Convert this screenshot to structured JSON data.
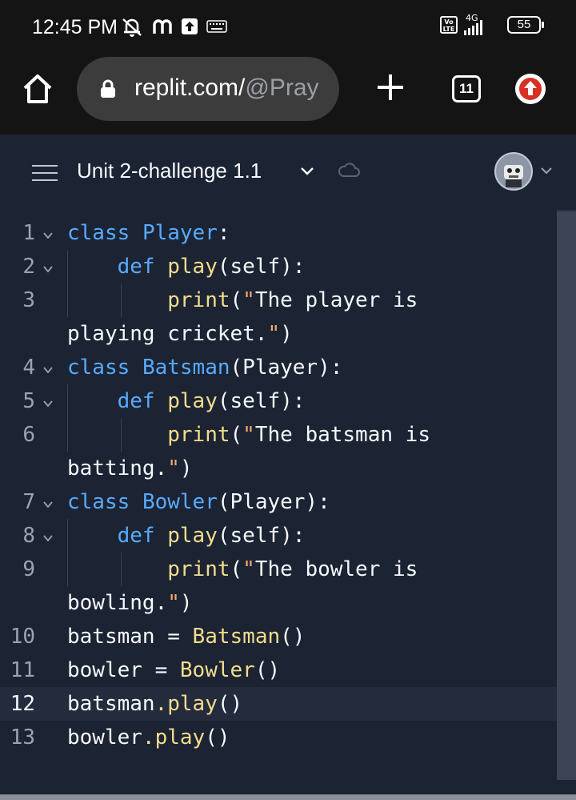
{
  "status_bar": {
    "time": "12:45 PM",
    "left_icons": [
      "mute-icon",
      "m-app-icon",
      "upload-icon",
      "keyboard-icon"
    ],
    "volte": "Vo LTE",
    "network": "4G",
    "battery": "55"
  },
  "browser": {
    "url_host": "replit.com/",
    "url_path": "@Pray",
    "tab_count": "11"
  },
  "replit": {
    "title": "Unit 2-challenge 1.1"
  },
  "editor": {
    "active_line": "12",
    "lines": [
      {
        "num": "1",
        "fold": true,
        "code": "class Player:"
      },
      {
        "num": "2",
        "fold": true,
        "code": "    def play(self):"
      },
      {
        "num": "3",
        "fold": false,
        "code": "        print(\"The player is"
      },
      {
        "num": "",
        "fold": false,
        "code": "playing cricket.\")"
      },
      {
        "num": "4",
        "fold": true,
        "code": "class Batsman(Player):"
      },
      {
        "num": "5",
        "fold": true,
        "code": "    def play(self):"
      },
      {
        "num": "6",
        "fold": false,
        "code": "        print(\"The batsman is"
      },
      {
        "num": "",
        "fold": false,
        "code": "batting.\")"
      },
      {
        "num": "7",
        "fold": true,
        "code": "class Bowler(Player):"
      },
      {
        "num": "8",
        "fold": true,
        "code": "    def play(self):"
      },
      {
        "num": "9",
        "fold": false,
        "code": "        print(\"The bowler is"
      },
      {
        "num": "",
        "fold": false,
        "code": "bowling.\")"
      },
      {
        "num": "10",
        "fold": false,
        "code": "batsman = Batsman()"
      },
      {
        "num": "11",
        "fold": false,
        "code": "bowler = Bowler()"
      },
      {
        "num": "12",
        "fold": false,
        "code": "batsman.play()"
      },
      {
        "num": "13",
        "fold": false,
        "code": "bowler.play()"
      }
    ]
  },
  "colors": {
    "background": "#1c2333",
    "keyword": "#57abff",
    "function": "#f2dd8c",
    "string": "#f3aa6f",
    "text": "#f5f9fc"
  }
}
